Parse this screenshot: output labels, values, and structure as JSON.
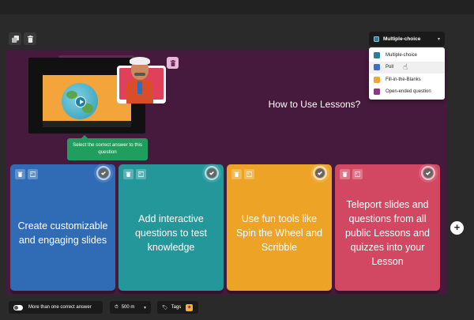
{
  "toolbar": {
    "duplicate_icon": "copy-icon",
    "delete_icon": "trash-icon"
  },
  "question_type": {
    "selected": "Multiple-choice",
    "options": [
      {
        "label": "Multiple-choice",
        "color": "#2d7c9a"
      },
      {
        "label": "Poll",
        "color": "#3a6fc4"
      },
      {
        "label": "Fill-in-the-Blanks",
        "color": "#f2a531"
      },
      {
        "label": "Open-ended question",
        "color": "#8a3a86"
      }
    ]
  },
  "media": {
    "tooltip": "Select the correct answer to this question"
  },
  "question": {
    "text": "How to Use Lessons?"
  },
  "answers": [
    {
      "text": "Create customizable and engaging slides",
      "color": "#2f6cb5"
    },
    {
      "text": "Add interactive questions to test knowledge",
      "color": "#24979a"
    },
    {
      "text": "Use fun tools like Spin the Wheel and Scribble",
      "color": "#eca326"
    },
    {
      "text": "Teleport slides and questions from all public Lessons and quizzes into your Lesson",
      "color": "#d24862"
    }
  ],
  "footer": {
    "multi_correct_label": "More than one correct answer",
    "time_value": "500 m",
    "tags_label": "Tags",
    "tags_add": "+"
  },
  "colors": {
    "canvas_bg": "#461a3c",
    "tooltip_bg": "#1f9e5e",
    "page_bg": "#2a2a2a"
  }
}
